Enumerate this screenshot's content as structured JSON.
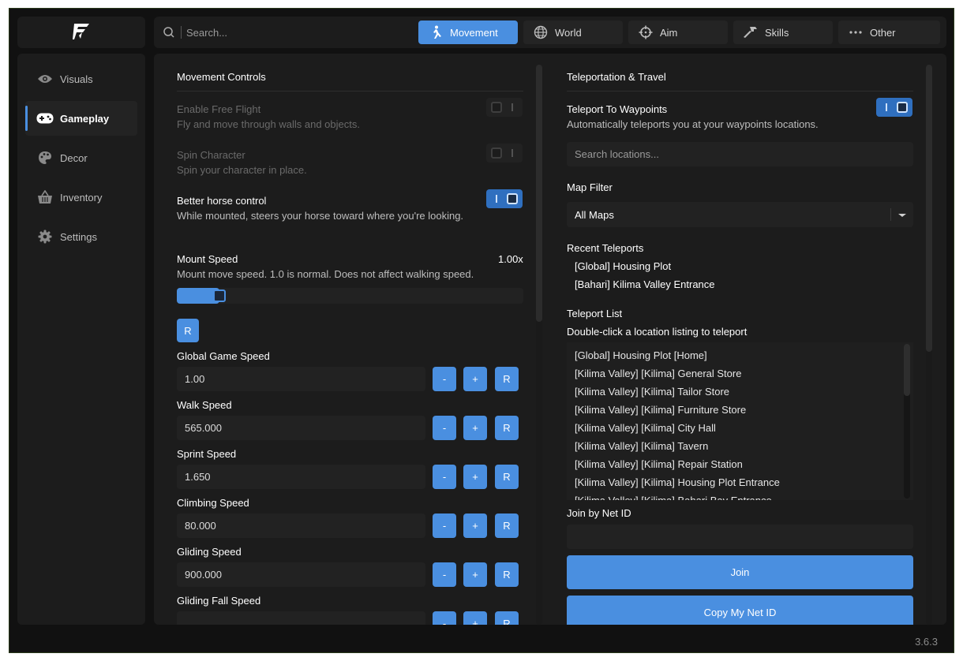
{
  "theme": {
    "accent": "#4a8fe0",
    "background": "#111111",
    "panel": "#1c1c1c"
  },
  "logo": {
    "icon": "brand-logo-icon"
  },
  "topbar": {
    "search_placeholder": "Search...",
    "tabs": [
      {
        "label": "Movement",
        "icon": "walking-person-icon",
        "active": true
      },
      {
        "label": "World",
        "icon": "globe-icon"
      },
      {
        "label": "Aim",
        "icon": "crosshair-icon"
      },
      {
        "label": "Skills",
        "icon": "hammer-icon"
      },
      {
        "label": "Other",
        "icon": "dots-icon"
      }
    ]
  },
  "sidebar": {
    "items": [
      {
        "label": "Visuals",
        "icon": "eye-icon"
      },
      {
        "label": "Gameplay",
        "icon": "gamepad-icon",
        "active": true
      },
      {
        "label": "Decor",
        "icon": "palette-icon"
      },
      {
        "label": "Inventory",
        "icon": "basket-icon"
      },
      {
        "label": "Settings",
        "icon": "gear-icon"
      }
    ]
  },
  "left": {
    "title": "Movement Controls",
    "toggles": [
      {
        "title": "Enable Free Flight",
        "desc": "Fly and move through walls and objects.",
        "on": false,
        "disabled": true
      },
      {
        "title": "Spin Character",
        "desc": "Spin your character in place.",
        "on": false,
        "disabled": true
      },
      {
        "title": "Better horse control",
        "desc": "While mounted, steers your horse toward where you're looking.",
        "on": true
      }
    ],
    "mount": {
      "title": "Mount Speed",
      "value": "1.00x",
      "desc": "Mount move speed. 1.0 is normal. Does not affect walking speed.",
      "fraction": 0.1,
      "reset": "R"
    },
    "speeds": [
      {
        "label": "Global Game Speed",
        "value": "1.00"
      },
      {
        "label": "Walk Speed",
        "value": "565.000"
      },
      {
        "label": "Sprint Speed",
        "value": "1.650"
      },
      {
        "label": "Climbing Speed",
        "value": "80.000"
      },
      {
        "label": "Gliding Speed",
        "value": "900.000"
      },
      {
        "label": "Gliding Fall Speed",
        "value": ""
      }
    ],
    "btn_minus": "-",
    "btn_plus": "+",
    "btn_reset": "R"
  },
  "right": {
    "title": "Teleportation & Travel",
    "waypoints": {
      "title": "Teleport To Waypoints",
      "desc": "Automatically teleports you at your waypoints locations.",
      "on": true
    },
    "search_placeholder": "Search locations...",
    "map_filter_label": "Map Filter",
    "map_filter_value": "All Maps",
    "recent_label": "Recent Teleports",
    "recent": [
      "[Global] Housing Plot",
      "[Bahari] Kilima Valley Entrance"
    ],
    "list_label": "Teleport List",
    "list_hint": "Double-click a location listing to teleport",
    "list": [
      "[Global] Housing Plot [Home]",
      "[Kilima Valley] [Kilima] General Store",
      "[Kilima Valley] [Kilima] Tailor Store",
      "[Kilima Valley] [Kilima] Furniture Store",
      "[Kilima Valley] [Kilima] City Hall",
      "[Kilima Valley] [Kilima] Tavern",
      "[Kilima Valley] [Kilima] Repair Station",
      "[Kilima Valley] [Kilima] Housing Plot Entrance",
      "[Kilima Valley] [Kilima] Bahari Bay Entrance"
    ],
    "netid_label": "Join by Net ID",
    "netid_value": "",
    "join_label": "Join",
    "copy_label": "Copy My Net ID"
  },
  "version": "3.6.3"
}
